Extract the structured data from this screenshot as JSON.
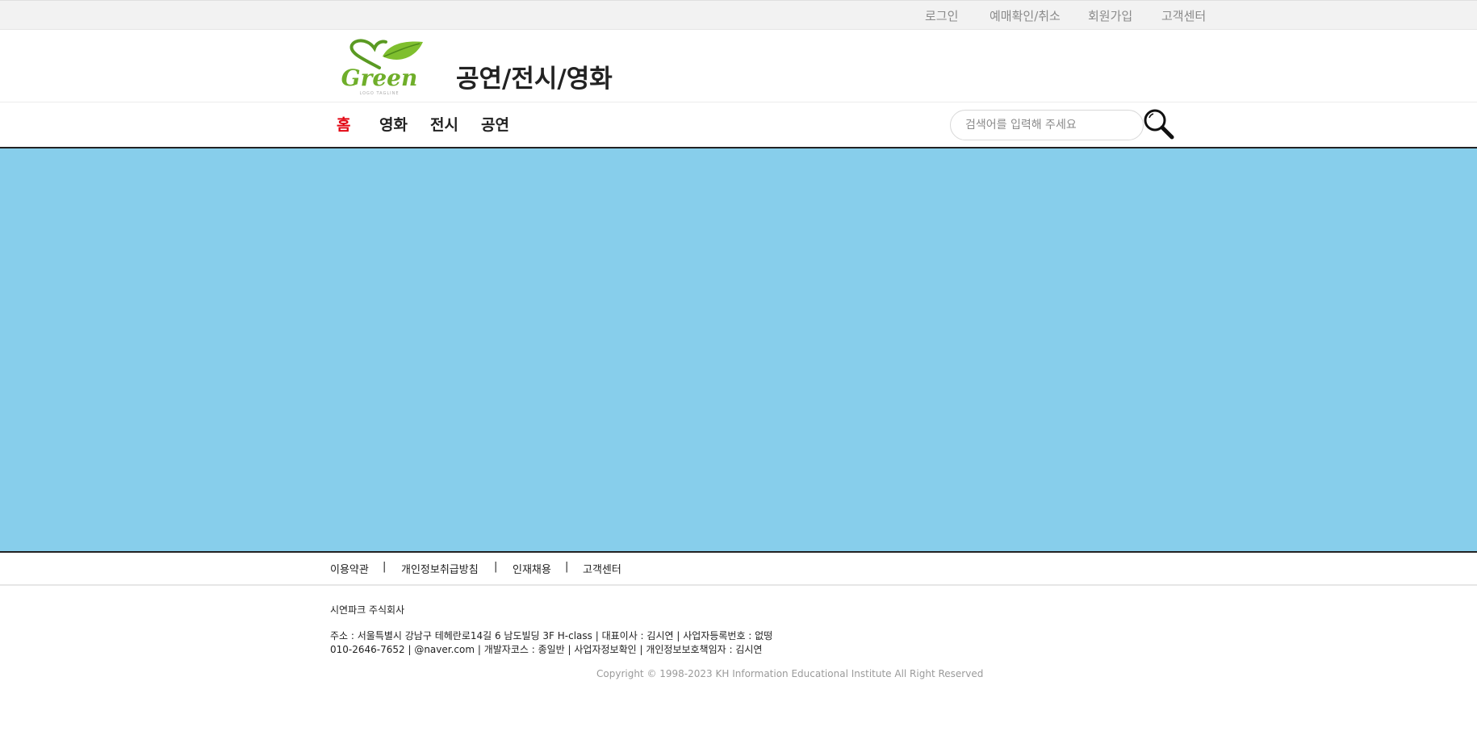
{
  "top_links": {
    "login": "로그인",
    "reservation": "예매확인/취소",
    "signup": "회원가입",
    "support": "고객센터"
  },
  "header": {
    "logo_text": "Green",
    "logo_tagline": "LOGO TAGLINE",
    "title": "공연/전시/영화"
  },
  "nav": {
    "home": "홈",
    "movie": "영화",
    "exhibition": "전시",
    "performance": "공연",
    "active_color": "#e30613"
  },
  "search": {
    "placeholder": "검색어를 입력해 주세요",
    "icon": "search-icon"
  },
  "banner": {
    "color": "#87ceeb"
  },
  "footer_nav": {
    "terms": "이용약관",
    "privacy": "개인정보취급방침",
    "careers": "인재채용",
    "support": "고객센터",
    "separator": "|"
  },
  "footer_info": {
    "company": "시연파크 주식회사",
    "address_line": "주소 : 서울특별시 강남구 테헤란로14길 6 남도빌딩 3F H-class | 대표이사 : 김시연 | 사업자등록번호 : 없떵",
    "contact_line": "010-2646-7652 | @naver.com | 개발자코스 : 종일반 | 사업자정보확인 | 개인정보보호책임자 : 김시연",
    "copyright": "Copyright © 1998-2023 KH Information Educational Institute All Right Reserved"
  }
}
